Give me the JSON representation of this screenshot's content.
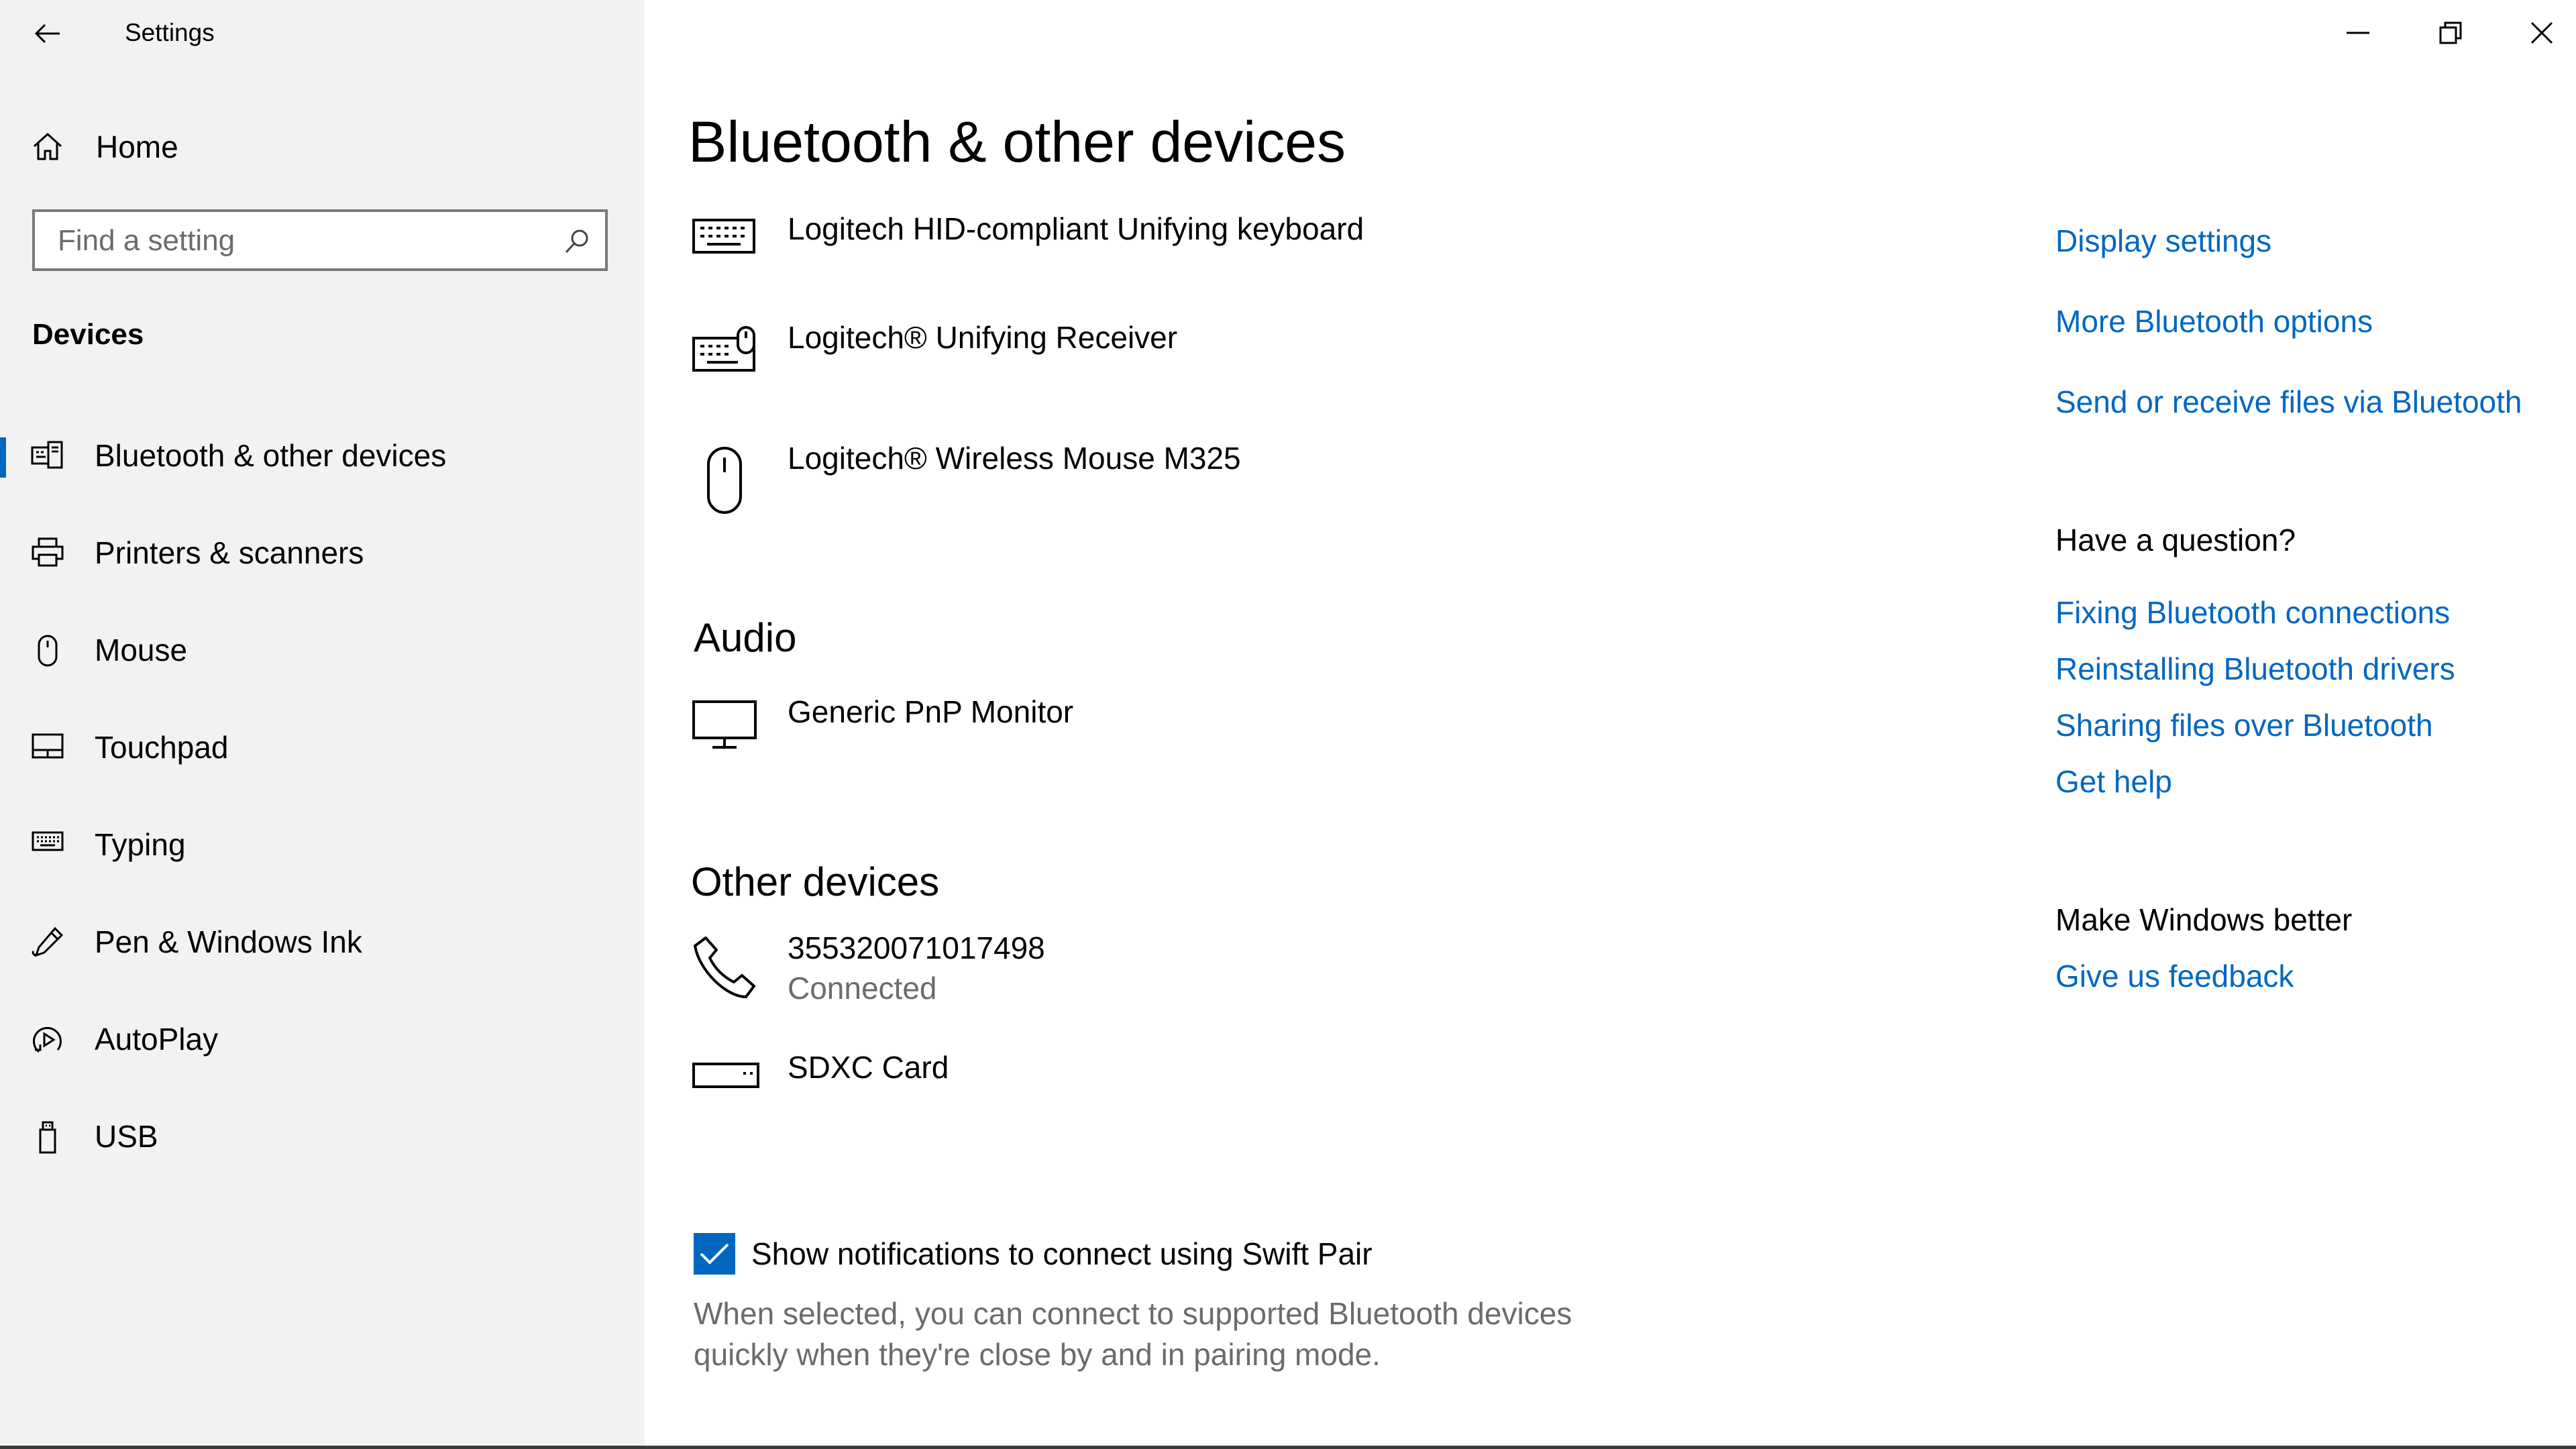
{
  "window": {
    "app_title": "Settings"
  },
  "sidebar": {
    "home_label": "Home",
    "search": {
      "placeholder": "Find a setting"
    },
    "section_title": "Devices",
    "items": [
      {
        "label": "Bluetooth & other devices",
        "icon": "bluetooth-devices-icon",
        "active": true
      },
      {
        "label": "Printers & scanners",
        "icon": "printer-icon"
      },
      {
        "label": "Mouse",
        "icon": "mouse-icon"
      },
      {
        "label": "Touchpad",
        "icon": "touchpad-icon"
      },
      {
        "label": "Typing",
        "icon": "keyboard-icon"
      },
      {
        "label": "Pen & Windows Ink",
        "icon": "pen-icon"
      },
      {
        "label": "AutoPlay",
        "icon": "autoplay-icon"
      },
      {
        "label": "USB",
        "icon": "usb-icon"
      }
    ]
  },
  "main": {
    "title": "Bluetooth & other devices",
    "input_devices": [
      {
        "name": "Logitech HID-compliant Unifying keyboard",
        "icon": "keyboard-icon"
      },
      {
        "name": "Logitech® Unifying Receiver",
        "icon": "keyboard-mouse-icon"
      },
      {
        "name": "Logitech® Wireless Mouse M325",
        "icon": "mouse-icon"
      }
    ],
    "audio": {
      "title": "Audio",
      "devices": [
        {
          "name": "Generic PnP Monitor",
          "icon": "monitor-icon"
        }
      ]
    },
    "other": {
      "title": "Other devices",
      "devices": [
        {
          "name": "355320071017498",
          "status": "Connected",
          "icon": "phone-icon"
        },
        {
          "name": "SDXC Card",
          "icon": "sd-card-icon"
        }
      ]
    },
    "swift_pair": {
      "checked": true,
      "label": "Show notifications to connect using Swift Pair",
      "description": "When selected, you can connect to supported Bluetooth devices quickly when they're close by and in pairing mode."
    }
  },
  "related": {
    "links": [
      "Display settings",
      "More Bluetooth options",
      "Send or receive files via Bluetooth"
    ],
    "question_title": "Have a question?",
    "help_links": [
      "Fixing Bluetooth connections",
      "Reinstalling Bluetooth drivers",
      "Sharing files over Bluetooth",
      "Get help"
    ],
    "feedback_title": "Make Windows better",
    "feedback_link": "Give us feedback"
  },
  "colors": {
    "accent": "#0067c0",
    "sidebar_bg": "#f2f2f2",
    "secondary_text": "#6b6b6b"
  }
}
